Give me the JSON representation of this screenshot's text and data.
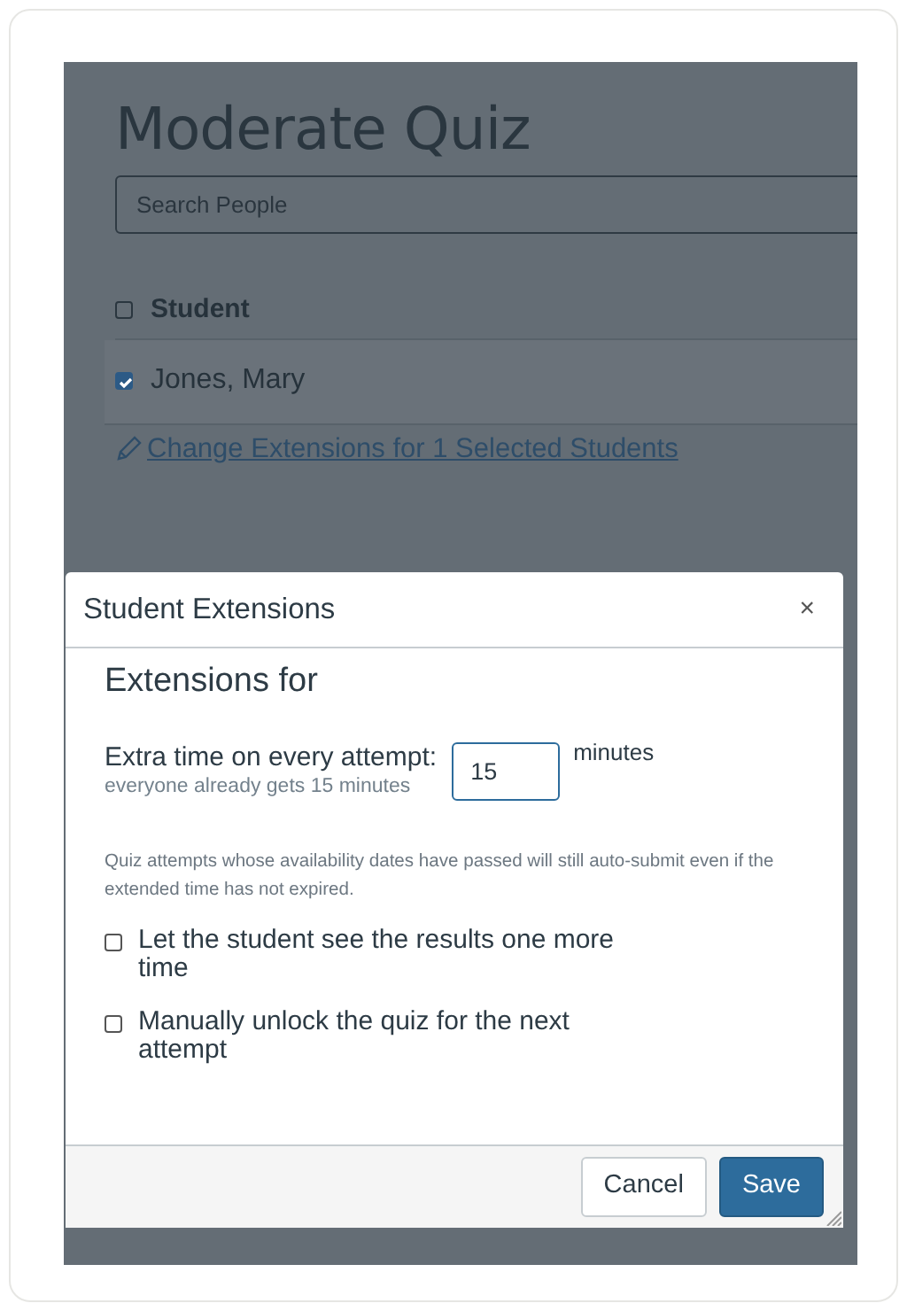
{
  "page": {
    "title": "Moderate Quiz",
    "search": {
      "placeholder": "Search People"
    },
    "table": {
      "header": {
        "label": "Student",
        "checked": false
      },
      "rows": [
        {
          "name": "Jones, Mary",
          "checked": true
        }
      ]
    },
    "link": "Change Extensions for 1 Selected Students"
  },
  "dialog": {
    "title": "Student Extensions",
    "close": "×",
    "heading": "Extensions for",
    "extra_time": {
      "label": "Extra time on every attempt:",
      "hint": "everyone already gets 15 minutes",
      "value": "15",
      "unit": "minutes"
    },
    "note": "Quiz attempts whose availability dates have passed will still auto-submit even if the extended time has not expired.",
    "options": [
      {
        "label": "Let the student see the results one more time",
        "checked": false
      },
      {
        "label": "Manually unlock the quiz for the next attempt",
        "checked": false
      }
    ],
    "buttons": [
      {
        "label": "Cancel",
        "kind": "secondary"
      },
      {
        "label": "Save",
        "kind": "primary"
      }
    ]
  }
}
